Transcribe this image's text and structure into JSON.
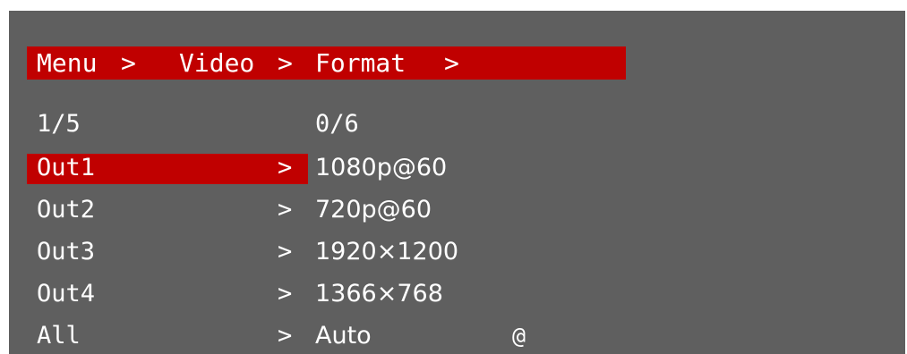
{
  "colors": {
    "background": "#5f5f5f",
    "highlight": "#c00000",
    "text": "#ffffff"
  },
  "breadcrumb": [
    "Menu",
    ">",
    "Video",
    ">",
    "Format",
    ">"
  ],
  "left_counter": "1/5",
  "right_counter": "0/6",
  "selected_index": 0,
  "rows": [
    {
      "label": "Out1",
      "arrow": ">",
      "value": "1080p@60",
      "extra": ""
    },
    {
      "label": "Out2",
      "arrow": ">",
      "value": "720p@60",
      "extra": ""
    },
    {
      "label": "Out3",
      "arrow": ">",
      "value": "1920×1200",
      "extra": ""
    },
    {
      "label": "Out4",
      "arrow": ">",
      "value": "1366×768",
      "extra": ""
    },
    {
      "label": "All",
      "arrow": ">",
      "value": "Auto",
      "extra": "@"
    }
  ]
}
